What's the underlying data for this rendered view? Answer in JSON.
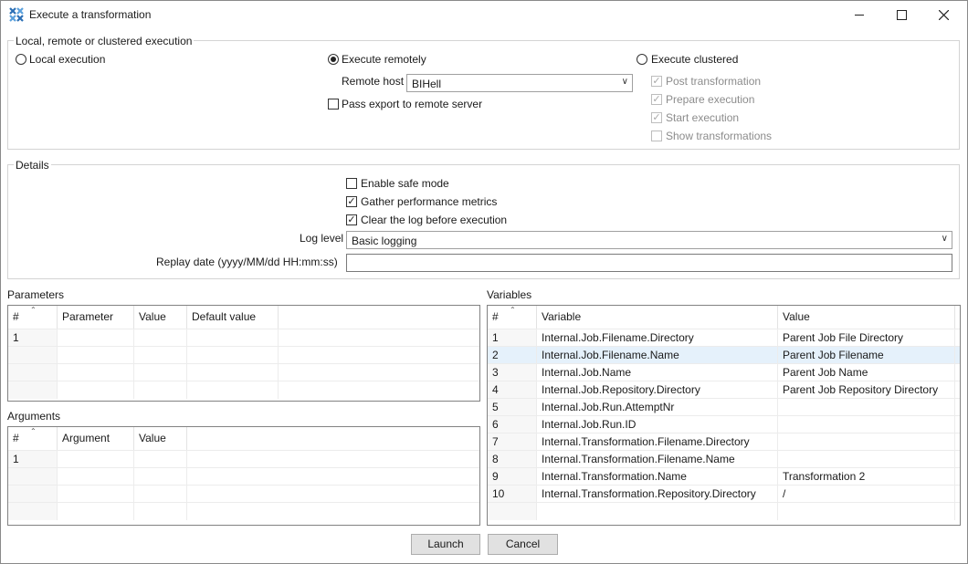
{
  "window": {
    "title": "Execute a transformation",
    "minimize_icon": "minimize-icon",
    "maximize_icon": "maximize-icon",
    "close_icon": "close-icon",
    "app_icon": "pentaho-spoon-icon"
  },
  "execution": {
    "group_label": "Local, remote or clustered execution",
    "local_label": "Local execution",
    "remote_label": "Execute remotely",
    "clustered_label": "Execute clustered",
    "selected": "remote",
    "remote_host_label": "Remote host",
    "remote_host_value": "BIHell",
    "pass_export_label": "Pass export to remote server",
    "pass_export_checked": false,
    "post_transformation_label": "Post transformation",
    "prepare_execution_label": "Prepare execution",
    "start_execution_label": "Start execution",
    "show_transformations_label": "Show transformations"
  },
  "details": {
    "group_label": "Details",
    "safe_mode_label": "Enable safe mode",
    "safe_mode_checked": false,
    "perf_metrics_label": "Gather performance metrics",
    "perf_metrics_checked": true,
    "clear_log_label": "Clear the log before execution",
    "clear_log_checked": true,
    "log_level_label": "Log level",
    "log_level_value": "Basic logging",
    "replay_date_label": "Replay date (yyyy/MM/dd HH:mm:ss)",
    "replay_date_value": ""
  },
  "parameters": {
    "label": "Parameters",
    "columns": [
      "#",
      "Parameter",
      "Value",
      "Default value"
    ],
    "rows": [
      [
        "1",
        "",
        "",
        ""
      ]
    ]
  },
  "arguments": {
    "label": "Arguments",
    "columns": [
      "#",
      "Argument",
      "Value"
    ],
    "rows": [
      [
        "1",
        "",
        ""
      ]
    ]
  },
  "variables": {
    "label": "Variables",
    "columns": [
      "#",
      "Variable",
      "Value"
    ],
    "selected_row": 1,
    "rows": [
      [
        "1",
        "Internal.Job.Filename.Directory",
        "Parent Job File Directory"
      ],
      [
        "2",
        "Internal.Job.Filename.Name",
        "Parent Job Filename"
      ],
      [
        "3",
        "Internal.Job.Name",
        "Parent Job Name"
      ],
      [
        "4",
        "Internal.Job.Repository.Directory",
        "Parent Job Repository Directory"
      ],
      [
        "5",
        "Internal.Job.Run.AttemptNr",
        ""
      ],
      [
        "6",
        "Internal.Job.Run.ID",
        ""
      ],
      [
        "7",
        "Internal.Transformation.Filename.Directory",
        ""
      ],
      [
        "8",
        "Internal.Transformation.Filename.Name",
        ""
      ],
      [
        "9",
        "Internal.Transformation.Name",
        "Transformation 2"
      ],
      [
        "10",
        "Internal.Transformation.Repository.Directory",
        "/"
      ]
    ]
  },
  "buttons": {
    "launch_label": "Launch",
    "cancel_label": "Cancel"
  }
}
